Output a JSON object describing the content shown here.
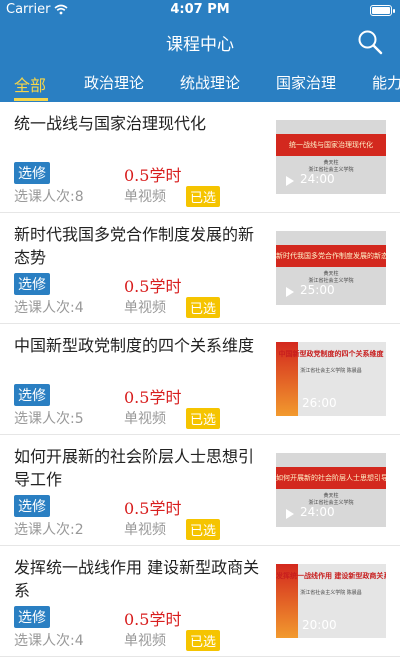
{
  "status_bar": {
    "carrier": "Carrier",
    "time": "4:07 PM"
  },
  "navbar": {
    "title": "课程中心"
  },
  "tabs": [
    {
      "label": "全部",
      "active": true
    },
    {
      "label": "政治理论",
      "active": false
    },
    {
      "label": "统战理论",
      "active": false
    },
    {
      "label": "国家治理",
      "active": false
    },
    {
      "label": "能力",
      "active": false
    }
  ],
  "courses": [
    {
      "title": "统一战线与国家治理现代化",
      "type_badge": "选修",
      "hours": "0.5学时",
      "students": "选课人次:8",
      "mode": "单视频",
      "status": "已选",
      "thumb": {
        "style": "banner",
        "banner_text": "统一战线与国家治理现代化",
        "speaker": "黄天柱",
        "org": "浙江省社会主义学院",
        "duration": "24:00"
      }
    },
    {
      "title": "新时代我国多党合作制度发展的新态势",
      "type_badge": "选修",
      "hours": "0.5学时",
      "students": "选课人次:4",
      "mode": "单视频",
      "status": "已选",
      "thumb": {
        "style": "banner",
        "banner_text": "新时代我国多党合作制度发展的新态势",
        "speaker": "黄天柱",
        "org": "浙江省社会主义学院",
        "duration": "25:00"
      }
    },
    {
      "title": "中国新型政党制度的四个关系维度",
      "type_badge": "选修",
      "hours": "0.5学时",
      "students": "选课人次:5",
      "mode": "单视频",
      "status": "已选",
      "thumb": {
        "style": "alt",
        "banner_text": "中国新型政党制度的四个关系维度",
        "speaker": "",
        "org": "浙江省社会主义学院 陈晨昌",
        "duration": "26:00"
      }
    },
    {
      "title": "如何开展新的社会阶层人士思想引导工作",
      "type_badge": "选修",
      "hours": "0.5学时",
      "students": "选课人次:2",
      "mode": "单视频",
      "status": "已选",
      "thumb": {
        "style": "banner",
        "banner_text": "如何开展新的社会阶层人士思想引导工作",
        "speaker": "黄天柱",
        "org": "浙江省社会主义学院",
        "duration": "24:00"
      }
    },
    {
      "title": "发挥统一战线作用 建设新型政商关系",
      "type_badge": "选修",
      "hours": "0.5学时",
      "students": "选课人次:4",
      "mode": "单视频",
      "status": "已选",
      "thumb": {
        "style": "alt",
        "banner_text": "发挥统一战线作用 建设新型政商关系",
        "speaker": "",
        "org": "浙江省社会主义学院 陈晨昌",
        "duration": "20:00"
      }
    }
  ]
}
